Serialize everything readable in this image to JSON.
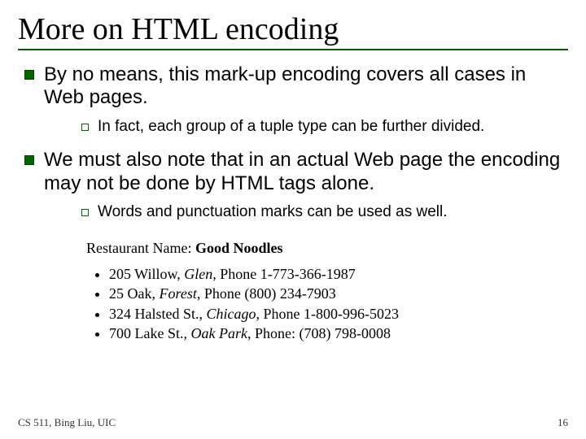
{
  "title": "More on HTML encoding",
  "bullets": {
    "b1": "By no means, this mark-up encoding covers all cases in Web pages.",
    "b1_sub": "In fact, each group of a tuple type can be further divided.",
    "b2": "We must also note that in an actual Web page the encoding may not be done by HTML tags alone.",
    "b2_sub": "Words and punctuation marks can be used as well."
  },
  "example": {
    "header_label": "Restaurant Name: ",
    "header_value": "Good Noodles",
    "rows": [
      {
        "addr": "205 Willow, ",
        "city": "Glen",
        "phone": ", Phone 1-773-366-1987"
      },
      {
        "addr": "25 Oak, ",
        "city": "Forest",
        "phone": ", Phone (800) 234-7903"
      },
      {
        "addr": "324 Halsted St., ",
        "city": "Chicago",
        "phone": ", Phone 1-800-996-5023"
      },
      {
        "addr": "700 Lake St., ",
        "city": "Oak Park",
        "phone": ", Phone: (708) 798-0008"
      }
    ]
  },
  "footer": {
    "left": "CS 511, Bing Liu, UIC",
    "right": "16"
  }
}
